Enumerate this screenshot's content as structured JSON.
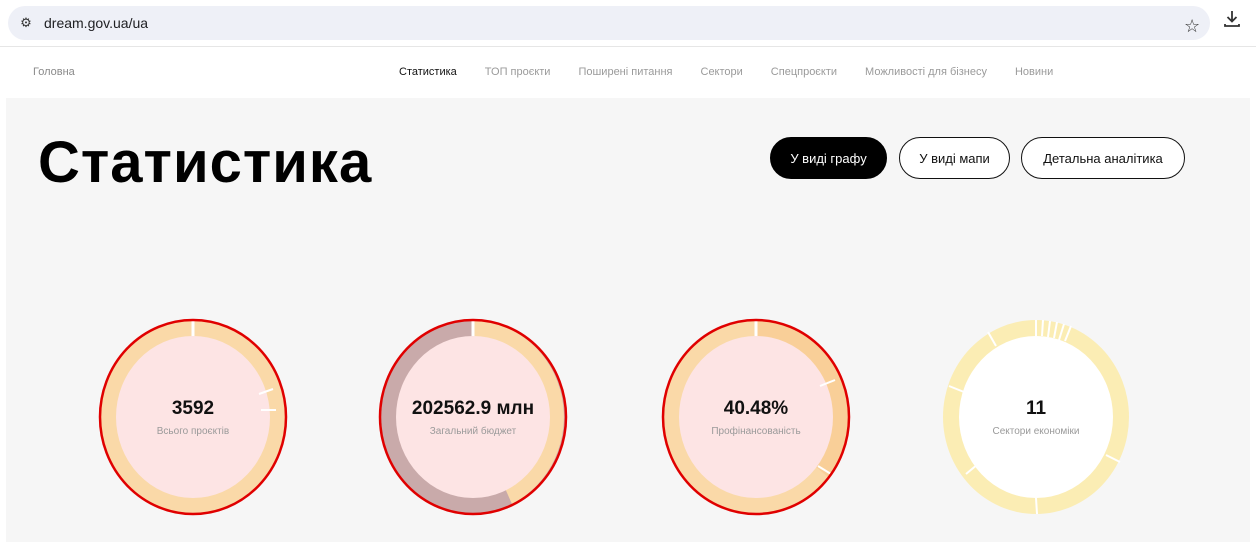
{
  "browser": {
    "url": "dream.gov.ua/ua"
  },
  "nav": {
    "home": "Головна",
    "links": [
      "Статистика",
      "ТОП проєкти",
      "Поширені питання",
      "Сектори",
      "Спецпроєкти",
      "Можливості для бізнесу",
      "Новини"
    ]
  },
  "page": {
    "title": "Статистика"
  },
  "view_buttons": [
    "У виді графу",
    "У виді мапи",
    "Детальна аналітика"
  ],
  "stats": [
    {
      "value": "3592",
      "label": "Всього проєктів"
    },
    {
      "value": "202562.9 млн",
      "label": "Загальний бюджет"
    },
    {
      "value": "40.48%",
      "label": "Профінансованість"
    },
    {
      "value": "11",
      "label": "Сектори економіки"
    }
  ],
  "colors": {
    "ring_orange": "#fad9a8",
    "ring_gray": "#c9aaaa",
    "ring_yellow": "#fbedb4",
    "center_pink": "#fde4e4",
    "highlight_red": "#e00000",
    "active_button": "#000000"
  },
  "chart_data": [
    {
      "type": "pie",
      "label": "Всього проєктів",
      "value_text": "3592"
    },
    {
      "type": "pie",
      "label": "Загальний бюджет",
      "value_text": "202562.9 млн"
    },
    {
      "type": "pie",
      "label": "Профінансованість",
      "value_text": "40.48%",
      "value": 40.48
    },
    {
      "type": "pie",
      "label": "Сектори економіки",
      "value_text": "11",
      "segments": 11
    }
  ]
}
